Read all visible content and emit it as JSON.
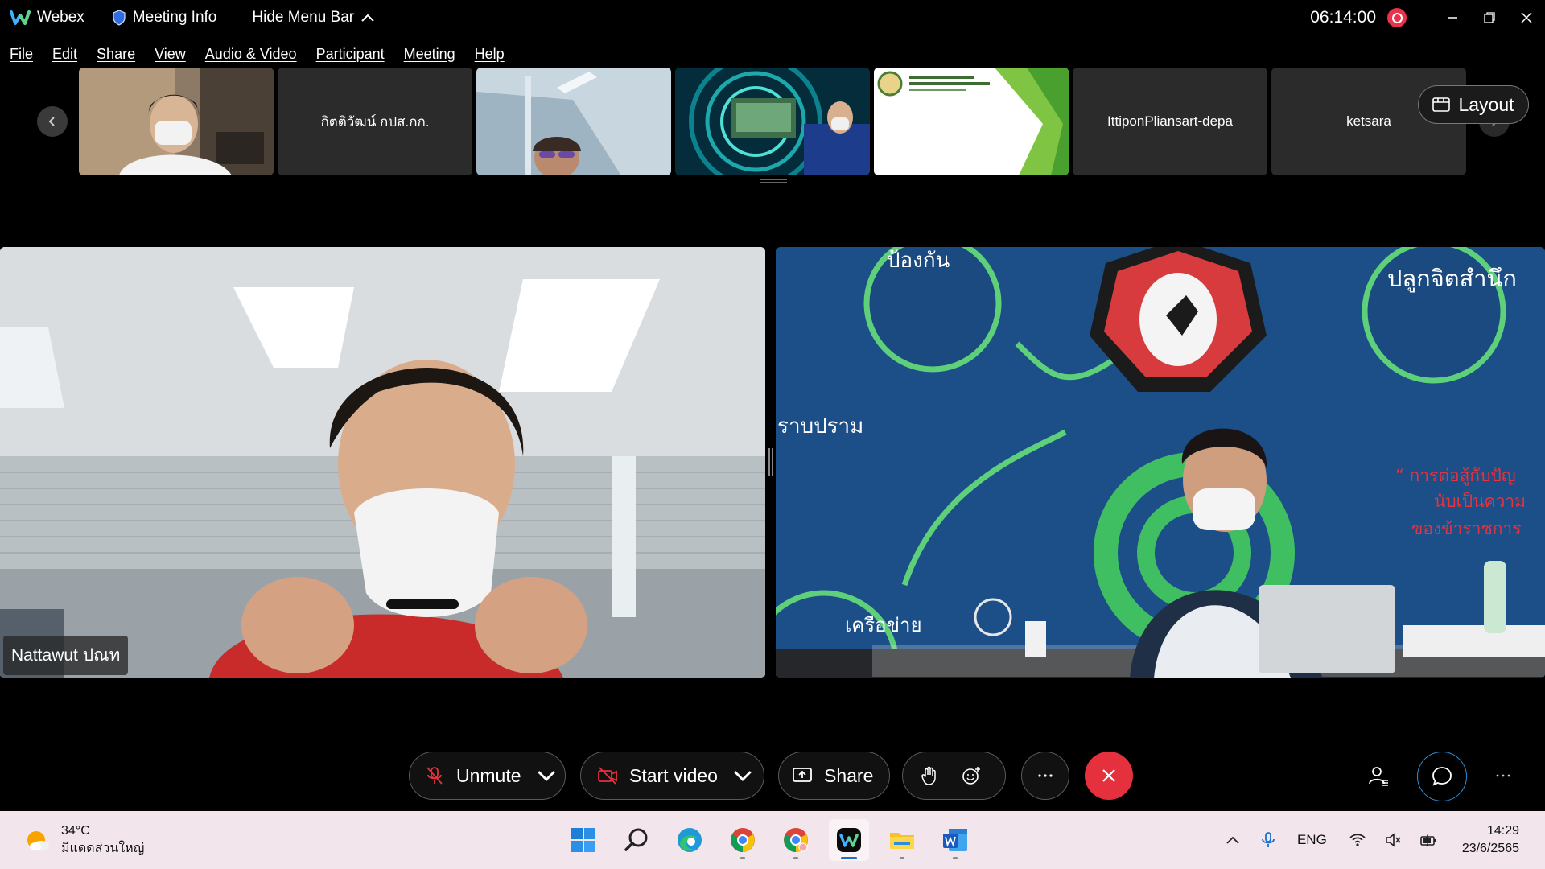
{
  "titlebar": {
    "app_name": "Webex",
    "meeting_info": "Meeting Info",
    "hide_menu_bar": "Hide Menu Bar",
    "clock": "06:14:00"
  },
  "menu": [
    "File",
    "Edit",
    "Share",
    "View",
    "Audio & Video",
    "Participant",
    "Meeting",
    "Help"
  ],
  "filmstrip": {
    "tiles": [
      {
        "type": "video",
        "label": ""
      },
      {
        "type": "name",
        "label": "กิตติวัฒน์ กปส.กก."
      },
      {
        "type": "video",
        "label": ""
      },
      {
        "type": "video",
        "label": ""
      },
      {
        "type": "video",
        "label": ""
      },
      {
        "type": "name",
        "label": "IttiponPliansart-depa"
      },
      {
        "type": "name",
        "label": "ketsara"
      }
    ],
    "layout_label": "Layout"
  },
  "main": {
    "left_name": "Nattawut ปณท",
    "right_poster": {
      "top_heading": "ป้องกัน",
      "right_heading": "ปลูกจิตสำนึก",
      "left_heading": "ราบปราม",
      "bottom_heading": "เครือข่าย",
      "red_text": "“ การต่อสู้กับปัญ",
      "red_text_2": "นับเป็นความ",
      "red_text_3": "ของข้าราชการ"
    }
  },
  "controls": {
    "unmute": "Unmute",
    "start_video": "Start video",
    "share": "Share",
    "end_color": "#e5303d"
  },
  "taskbar": {
    "temperature": "34°C",
    "weather_desc": "มีแดดส่วนใหญ่",
    "language": "ENG",
    "time": "14:29",
    "date": "23/6/2565"
  }
}
